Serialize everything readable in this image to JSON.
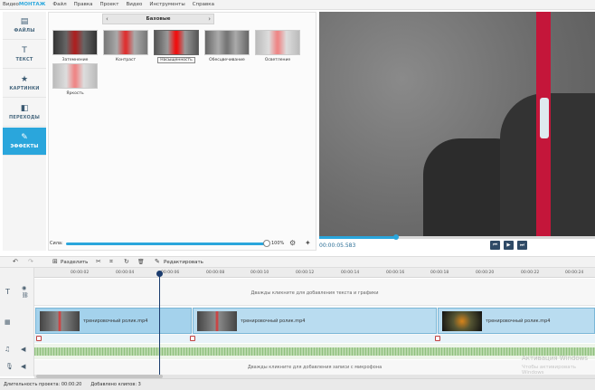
{
  "app": {
    "logo_pre": "Видео",
    "logo_brand": "МОНТАЖ"
  },
  "menu": [
    "Файл",
    "Правка",
    "Проект",
    "Видео",
    "Инструменты",
    "Справка"
  ],
  "sidebar": {
    "items": [
      {
        "label": "ФАЙЛЫ",
        "icon": "files-icon",
        "glyph": "▤"
      },
      {
        "label": "ТЕКСТ",
        "icon": "text-icon",
        "glyph": "T"
      },
      {
        "label": "КАРТИНКИ",
        "icon": "star-icon",
        "glyph": "★"
      },
      {
        "label": "ПЕРЕХОДЫ",
        "icon": "transitions-icon",
        "glyph": "◧"
      },
      {
        "label": "ЭФФЕКТЫ",
        "icon": "effects-icon",
        "glyph": "✎",
        "active": true
      }
    ]
  },
  "effects": {
    "category": "Базовые",
    "prev": "‹",
    "next": "›",
    "items": [
      {
        "label": "Затемнение"
      },
      {
        "label": "Контраст"
      },
      {
        "label": "Насыщенность",
        "selected": true
      },
      {
        "label": "Обесцвечивание"
      },
      {
        "label": "Осветление"
      },
      {
        "label": "Яркость"
      }
    ],
    "strength_label": "Сила:",
    "strength_value": "100%",
    "strength_fraction": 1.0
  },
  "player": {
    "time": "00:00:05.583",
    "progress_fraction": 0.28,
    "buttons": [
      "⏮",
      "▶",
      "⏭"
    ]
  },
  "toolbar": {
    "undo": "↶",
    "redo": "↷",
    "split_label": "Разделить",
    "scissors": "✂",
    "crop": "⌗",
    "rotate": "↻",
    "trash": "🗑",
    "edit_label": "Редактировать"
  },
  "ruler": {
    "ticks": [
      "00:00:02",
      "00:00:04",
      "00:00:06",
      "00:00:08",
      "00:00:10",
      "00:00:12",
      "00:00:14",
      "00:00:16",
      "00:00:18",
      "00:00:20",
      "00:00:22",
      "00:00:24"
    ]
  },
  "timeline": {
    "text_hint": "Дважды кликните для добавления текста и графики",
    "mic_hint": "Дважды кликните для добавления записи с микрофона",
    "clips": [
      {
        "name": "тренировочный ролик.mp4"
      },
      {
        "name": "тренировочный ролик.mp4"
      },
      {
        "name": "тренировочный ролик.mp4"
      }
    ]
  },
  "status": {
    "duration": "Длительность проекта: 00:00:20",
    "added": "Добавлено клипов: 3"
  },
  "watermark": {
    "line1": "Активация Windows",
    "line2": "Чтобы активировать Windows"
  }
}
